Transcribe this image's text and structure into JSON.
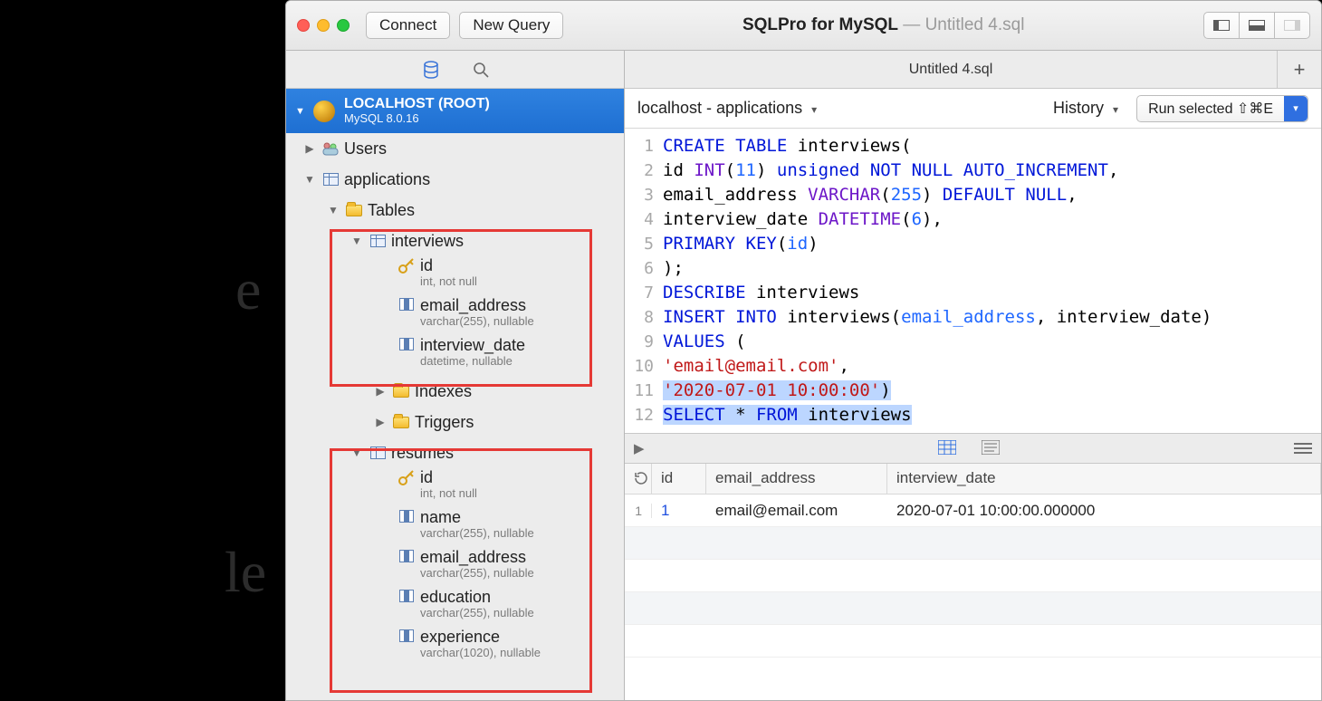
{
  "toolbar": {
    "connect": "Connect",
    "new_query": "New Query",
    "app_name": "SQLPro for MySQL",
    "doc_name": "Untitled 4.sql"
  },
  "sidebar": {
    "connection": {
      "name": "LOCALHOST (ROOT)",
      "engine": "MySQL 8.0.16"
    },
    "users_label": "Users",
    "db": {
      "name": "applications",
      "tables_label": "Tables",
      "indexes_label": "Indexes",
      "triggers_label": "Triggers",
      "interviews": {
        "name": "interviews",
        "cols": {
          "id": {
            "name": "id",
            "type": "int, not null"
          },
          "email": {
            "name": "email_address",
            "type": "varchar(255), nullable"
          },
          "date": {
            "name": "interview_date",
            "type": "datetime, nullable"
          }
        }
      },
      "resumes": {
        "name": "resumes",
        "cols": {
          "id": {
            "name": "id",
            "type": "int, not null"
          },
          "name": {
            "name": "name",
            "type": "varchar(255), nullable"
          },
          "email": {
            "name": "email_address",
            "type": "varchar(255), nullable"
          },
          "edu": {
            "name": "education",
            "type": "varchar(255), nullable"
          },
          "exp": {
            "name": "experience",
            "type": "varchar(1020), nullable"
          }
        }
      }
    }
  },
  "tabs": {
    "active": "Untitled 4.sql"
  },
  "context": {
    "scope": "localhost - applications",
    "history": "History",
    "run": "Run selected ⇧⌘E"
  },
  "editor": {
    "l1": {
      "a": "CREATE TABLE",
      "b": " interviews("
    },
    "l2": {
      "a": "id ",
      "b": "INT",
      "c": "(",
      "d": "11",
      "e": ") ",
      "f": "unsigned NOT NULL AUTO_INCREMENT",
      "g": ","
    },
    "l3": {
      "a": "email_address ",
      "b": "VARCHAR",
      "c": "(",
      "d": "255",
      "e": ") ",
      "f": "DEFAULT NULL",
      "g": ","
    },
    "l4": {
      "a": "interview_date ",
      "b": "DATETIME",
      "c": "(",
      "d": "6",
      "e": "),"
    },
    "l5": {
      "a": "PRIMARY KEY",
      "b": "(",
      "c": "id",
      "d": ")"
    },
    "l6": {
      "a": ");"
    },
    "l7": {
      "a": "DESCRIBE",
      "b": " interviews"
    },
    "l8": {
      "a": "INSERT INTO",
      "b": " interviews(",
      "c": "email_address",
      "d": ", interview_date)"
    },
    "l9": {
      "a": "VALUES",
      "b": " ("
    },
    "l10": {
      "a": "'email@email.com'",
      "b": ","
    },
    "l11": {
      "a": "'2020-07-01 10:00:00'",
      "b": ")"
    },
    "l12": {
      "a": "SELECT",
      "b": " * ",
      "c": "FROM",
      "d": " interviews"
    },
    "nums": {
      "1": "1",
      "2": "2",
      "3": "3",
      "4": "4",
      "5": "5",
      "6": "6",
      "7": "7",
      "8": "8",
      "9": "9",
      "10": "10",
      "11": "11",
      "12": "12"
    }
  },
  "results": {
    "headers": {
      "id": "id",
      "email": "email_address",
      "date": "interview_date"
    },
    "row1": {
      "n": "1",
      "id": "1",
      "email": "email@email.com",
      "date": "2020-07-01 10:00:00.000000"
    }
  },
  "bg": {
    "e": "e",
    "le": "le"
  }
}
